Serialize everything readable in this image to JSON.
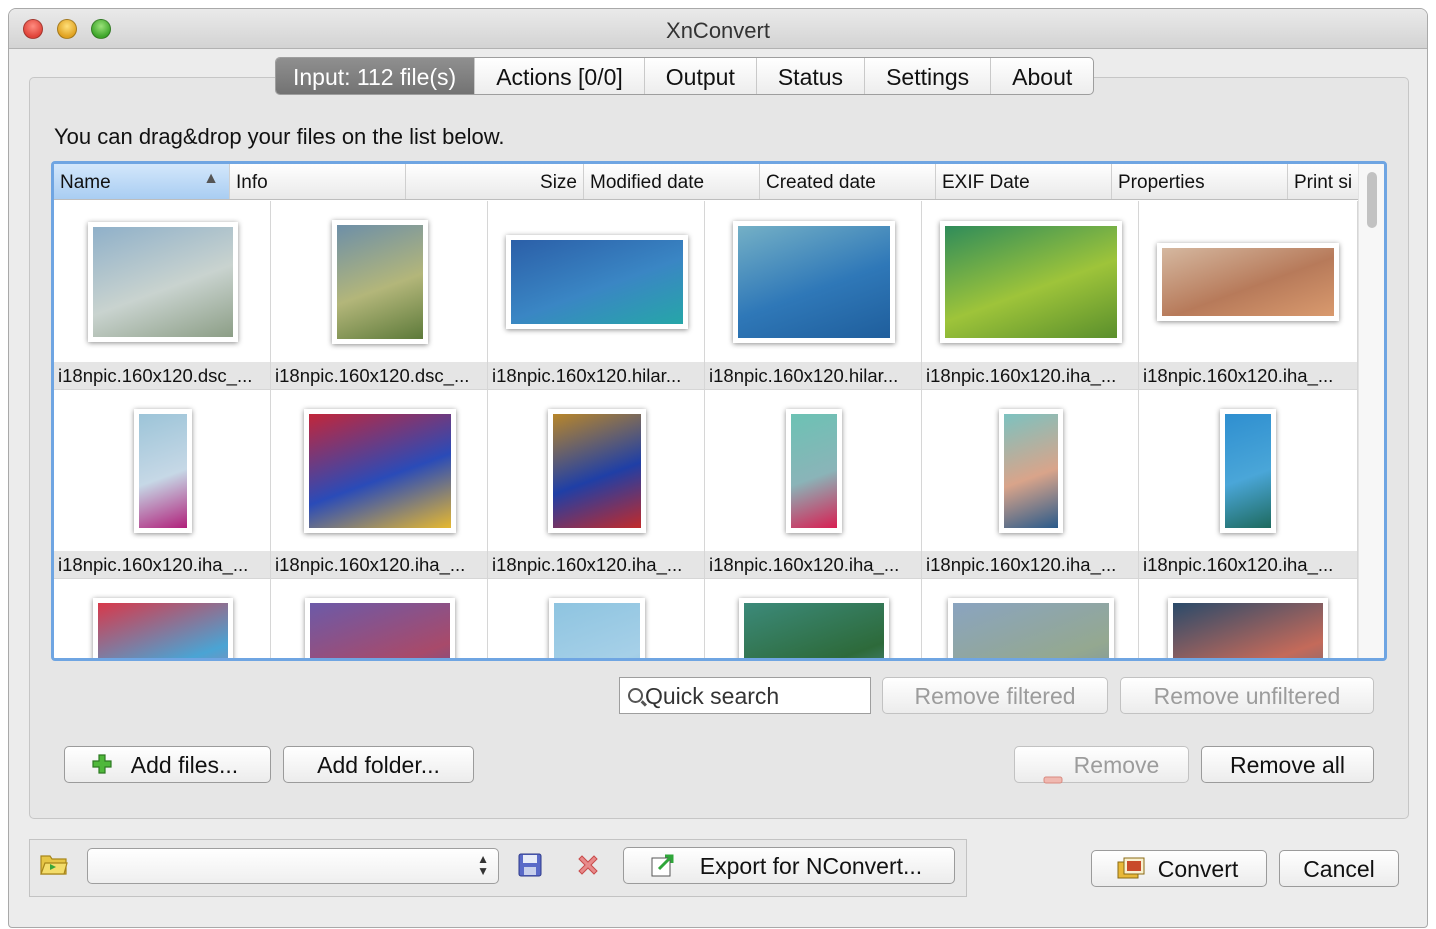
{
  "window": {
    "title": "XnConvert"
  },
  "tabs": [
    {
      "label": "Input: 112 file(s)",
      "active": true
    },
    {
      "label": "Actions [0/0]",
      "active": false
    },
    {
      "label": "Output",
      "active": false
    },
    {
      "label": "Status",
      "active": false
    },
    {
      "label": "Settings",
      "active": false
    },
    {
      "label": "About",
      "active": false
    }
  ],
  "input": {
    "hint": "You can drag&drop your files on the list below.",
    "columns": [
      "Name",
      "Info",
      "Size",
      "Modified date",
      "Created date",
      "EXIF Date",
      "Properties",
      "Print si"
    ],
    "sorted_column": "Name",
    "thumbnails": [
      {
        "caption": "i18npic.160x120.dsc_...",
        "colors": [
          "#8fb0c9",
          "#c9d3cf",
          "#8c9e86"
        ]
      },
      {
        "caption": "i18npic.160x120.dsc_...",
        "colors": [
          "#6d8fa8",
          "#b3b67a",
          "#5d7a3a"
        ]
      },
      {
        "caption": "i18npic.160x120.hilar...",
        "colors": [
          "#2b5fa8",
          "#3a86c4",
          "#26a6a8"
        ]
      },
      {
        "caption": "i18npic.160x120.hilar...",
        "colors": [
          "#74b0c6",
          "#2f78b8",
          "#1f5e9c"
        ]
      },
      {
        "caption": "i18npic.160x120.iha_...",
        "colors": [
          "#2f8c5a",
          "#9ec43a",
          "#5a8f2c"
        ]
      },
      {
        "caption": "i18npic.160x120.iha_...",
        "colors": [
          "#d5b8a0",
          "#b77a5a",
          "#d99a6e"
        ]
      },
      {
        "caption": "i18npic.160x120.iha_...",
        "colors": [
          "#9cc4d8",
          "#c6d8e6",
          "#b0207a"
        ]
      },
      {
        "caption": "i18npic.160x120.iha_...",
        "colors": [
          "#c2263a",
          "#2a4bb8",
          "#e6b830"
        ]
      },
      {
        "caption": "i18npic.160x120.iha_...",
        "colors": [
          "#b8862a",
          "#1f3fa6",
          "#c22a2a"
        ]
      },
      {
        "caption": "i18npic.160x120.iha_...",
        "colors": [
          "#6cc2b4",
          "#8ab4b8",
          "#d81f52"
        ]
      },
      {
        "caption": "i18npic.160x120.iha_...",
        "colors": [
          "#7cc2c0",
          "#d9a48a",
          "#2a5a8a"
        ]
      },
      {
        "caption": "i18npic.160x120.iha_...",
        "colors": [
          "#2f8fd0",
          "#4aa6d8",
          "#1e6a5e"
        ]
      },
      {
        "caption": "",
        "colors": [
          "#d8384a",
          "#4aa4d4",
          "#e06a8a"
        ]
      },
      {
        "caption": "",
        "colors": [
          "#6c5aa8",
          "#a84a6a",
          "#3a5aa8"
        ]
      },
      {
        "caption": "",
        "colors": [
          "#8ec4e0",
          "#a6d0e8",
          "#7eb8d8"
        ]
      },
      {
        "caption": "",
        "colors": [
          "#3c8a7a",
          "#2d6a3a",
          "#6aa4c8"
        ]
      },
      {
        "caption": "",
        "colors": [
          "#8aa4c0",
          "#94a890",
          "#6a84a8"
        ]
      },
      {
        "caption": "",
        "colors": [
          "#2a4a6a",
          "#c46a5a",
          "#3a6a8a"
        ]
      }
    ],
    "search_placeholder": "Quick search",
    "buttons": {
      "remove_filtered": "Remove filtered",
      "remove_unfiltered": "Remove unfiltered",
      "add_files": "Add files...",
      "add_folder": "Add folder...",
      "remove": "Remove",
      "remove_all": "Remove all"
    }
  },
  "footer": {
    "preset_value": "",
    "export_label": "Export for NConvert...",
    "convert_label": "Convert",
    "cancel_label": "Cancel"
  },
  "icons": {
    "folder": "folder-open-icon",
    "save": "floppy-disk-icon",
    "delete": "red-x-icon",
    "export": "export-icon",
    "convert": "convert-icon",
    "add": "green-plus-icon",
    "remove": "minus-icon"
  }
}
